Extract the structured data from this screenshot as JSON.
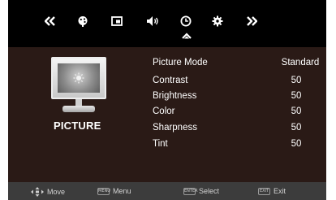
{
  "top_menu": {
    "items": [
      {
        "name": "prev-page",
        "icon": "double-chevron-left-icon"
      },
      {
        "name": "picture",
        "icon": "palette-icon"
      },
      {
        "name": "screen",
        "icon": "screen-icon"
      },
      {
        "name": "sound",
        "icon": "speaker-icon"
      },
      {
        "name": "time",
        "icon": "clock-icon",
        "selected": true
      },
      {
        "name": "setup",
        "icon": "gear-icon"
      },
      {
        "name": "next-page",
        "icon": "double-chevron-right-icon"
      }
    ]
  },
  "section": {
    "title": "PICTURE",
    "icon": "tv-brightness-icon"
  },
  "settings": [
    {
      "label": "Picture  Mode",
      "value": "Standard"
    },
    {
      "label": "Contrast",
      "value": "50"
    },
    {
      "label": "Brightness",
      "value": "50"
    },
    {
      "label": "Color",
      "value": "50"
    },
    {
      "label": "Sharpness",
      "value": "50"
    },
    {
      "label": "Tint",
      "value": "50"
    }
  ],
  "footer": {
    "hints": [
      {
        "key": "",
        "label": "Move",
        "icon": "dpad-icon"
      },
      {
        "key": "MENU",
        "label": "Menu"
      },
      {
        "key": "ENTER",
        "label": "Select"
      },
      {
        "key": "EXIT",
        "label": "Exit"
      }
    ]
  },
  "colors": {
    "panel": "#2a1a16",
    "topbar": "#000000",
    "footer": "#3c3c3c",
    "text": "#ffffff"
  }
}
